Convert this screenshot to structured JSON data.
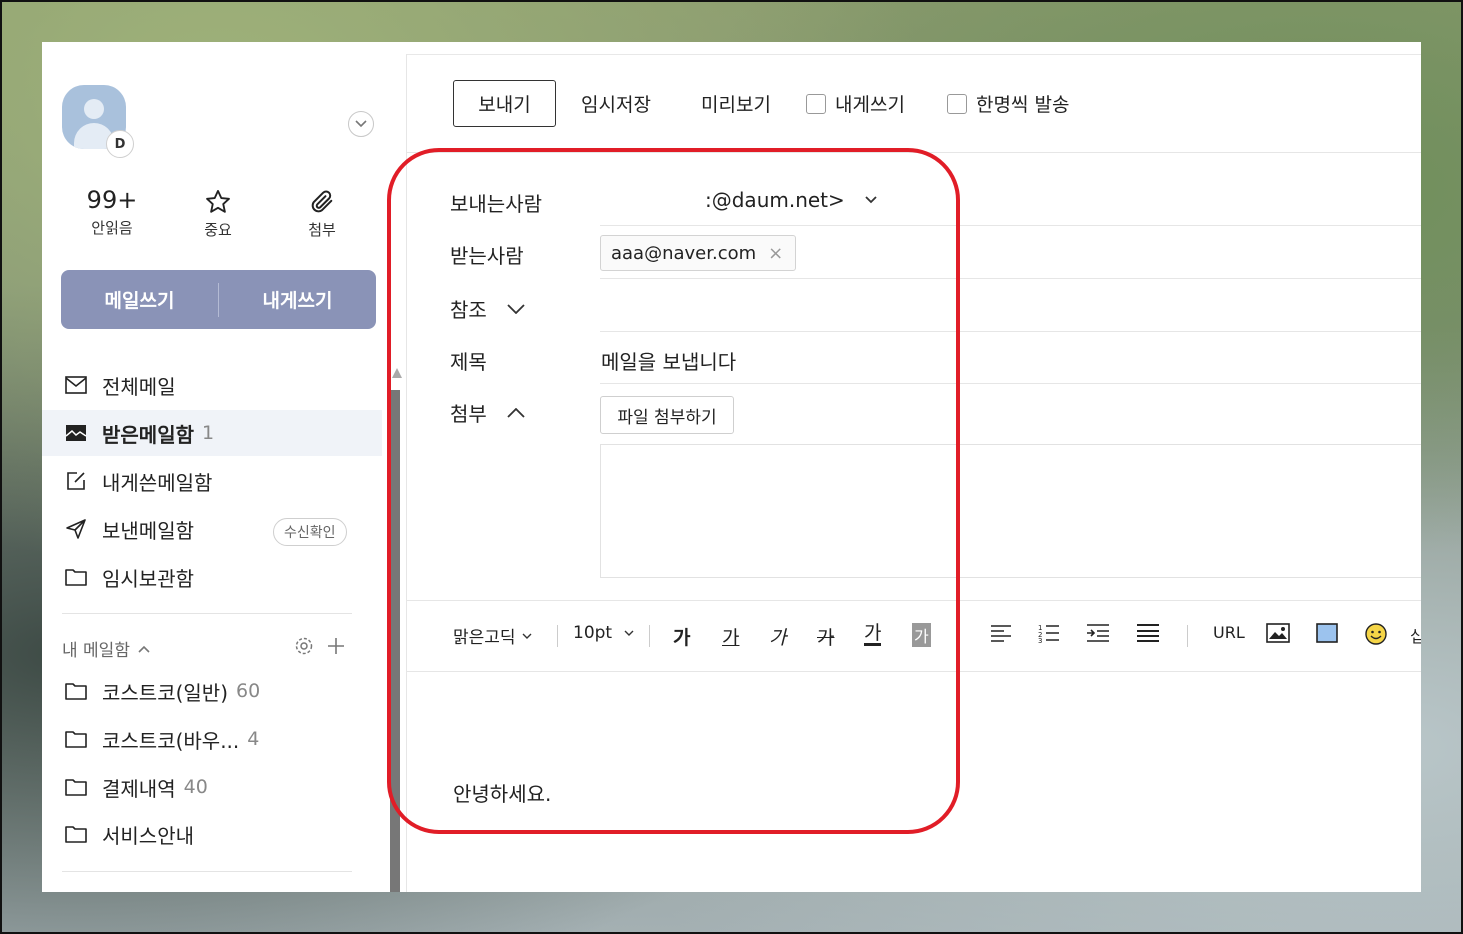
{
  "sidebar": {
    "avatar_badge": "D",
    "quick": {
      "unread_count": "99+",
      "unread_label": "안읽음",
      "important_label": "중요",
      "attach_label": "첨부"
    },
    "write_label": "메일쓰기",
    "self_write_label": "내게쓰기",
    "items": [
      {
        "label": "전체메일",
        "icon": "mail-icon"
      },
      {
        "label": "받은메일함",
        "count": "1",
        "icon": "inbox-icon"
      },
      {
        "label": "내게쓴메일함",
        "icon": "edit-icon"
      },
      {
        "label": "보낸메일함",
        "icon": "send-icon",
        "pill": "수신확인"
      },
      {
        "label": "임시보관함",
        "icon": "folder-icon"
      }
    ],
    "my_mailbox_title": "내 메일함",
    "folders": [
      {
        "label": "코스트코(일반)",
        "count": "60"
      },
      {
        "label": "코스트코(바우...",
        "count": "4"
      },
      {
        "label": "결제내역",
        "count": "40"
      },
      {
        "label": "서비스안내",
        "count": ""
      }
    ]
  },
  "toolbar": {
    "send": "보내기",
    "save_draft": "임시저장",
    "preview": "미리보기",
    "to_self": "내게쓰기",
    "individual_send": "한명씩 발송"
  },
  "compose": {
    "from_label": "보내는사람",
    "from_value": ":@daum.net>",
    "to_label": "받는사람",
    "to_chip": "aaa@naver.com",
    "cc_label": "참조",
    "subject_label": "제목",
    "subject_value": "메일을 보냅니다",
    "attach_label": "첨부",
    "attach_button": "파일 첨부하기",
    "body_text": "안녕하세요."
  },
  "editor": {
    "font": "맑은고딕",
    "size": "10pt",
    "bold": "가",
    "underline": "가",
    "italic": "가",
    "strike": "가",
    "text_color": "가",
    "bg_color": "가",
    "url": "URL",
    "more": "십"
  },
  "colors": {
    "accent": "#8a93b7",
    "highlight": "#e11d27",
    "active_bg": "#f0f3f8"
  }
}
